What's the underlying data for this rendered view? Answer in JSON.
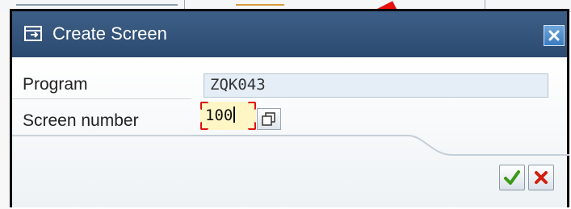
{
  "dialog": {
    "title": "Create Screen",
    "title_icon": "create-screen-icon",
    "close_icon": "close-icon"
  },
  "form": {
    "program_label": "Program",
    "program_value": "ZQK043",
    "screen_label": "Screen number",
    "screen_value": "100"
  },
  "buttons": {
    "continue_icon": "checkmark-icon",
    "cancel_icon": "cancel-x-icon"
  },
  "colors": {
    "titlebar": "#2c4a70",
    "required_field_bg": "#fff5c5",
    "focus_frame": "#e01010",
    "confirm_green": "#3a9a18",
    "cancel_red": "#d02010"
  }
}
